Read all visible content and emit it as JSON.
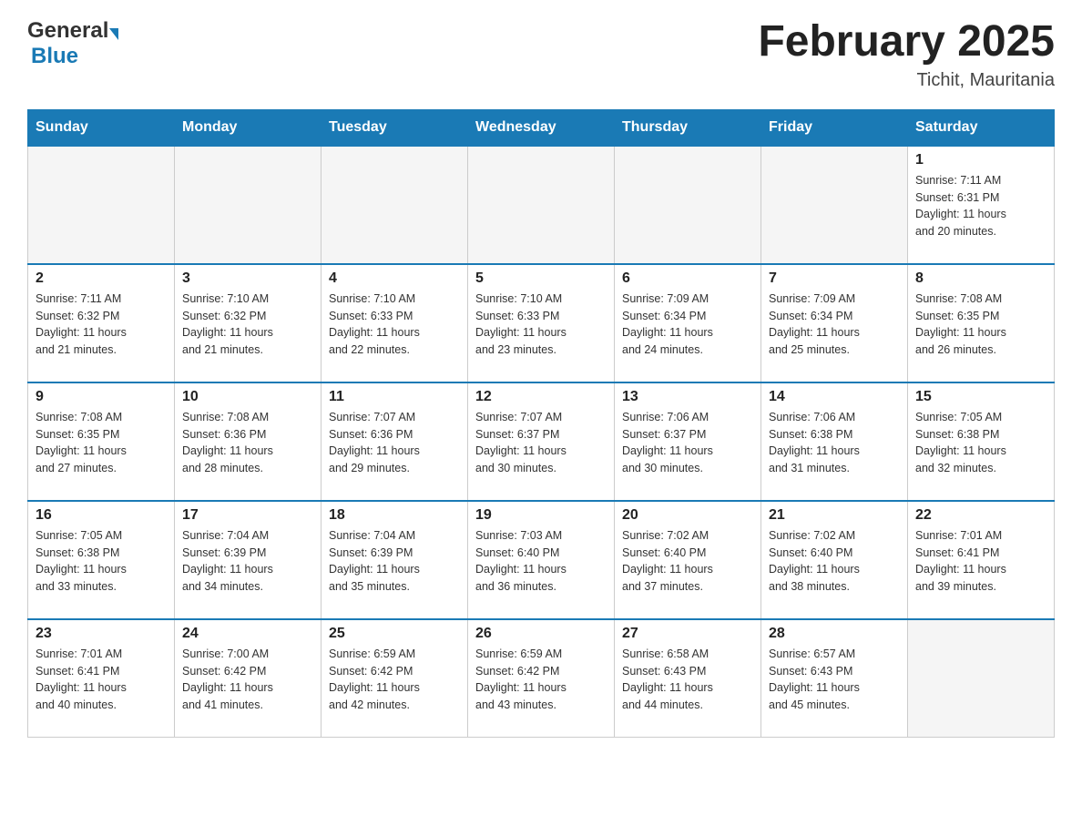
{
  "header": {
    "logo_general": "General",
    "logo_blue": "Blue",
    "title": "February 2025",
    "location": "Tichit, Mauritania"
  },
  "weekdays": [
    "Sunday",
    "Monday",
    "Tuesday",
    "Wednesday",
    "Thursday",
    "Friday",
    "Saturday"
  ],
  "weeks": [
    [
      {
        "day": "",
        "info": ""
      },
      {
        "day": "",
        "info": ""
      },
      {
        "day": "",
        "info": ""
      },
      {
        "day": "",
        "info": ""
      },
      {
        "day": "",
        "info": ""
      },
      {
        "day": "",
        "info": ""
      },
      {
        "day": "1",
        "info": "Sunrise: 7:11 AM\nSunset: 6:31 PM\nDaylight: 11 hours\nand 20 minutes."
      }
    ],
    [
      {
        "day": "2",
        "info": "Sunrise: 7:11 AM\nSunset: 6:32 PM\nDaylight: 11 hours\nand 21 minutes."
      },
      {
        "day": "3",
        "info": "Sunrise: 7:10 AM\nSunset: 6:32 PM\nDaylight: 11 hours\nand 21 minutes."
      },
      {
        "day": "4",
        "info": "Sunrise: 7:10 AM\nSunset: 6:33 PM\nDaylight: 11 hours\nand 22 minutes."
      },
      {
        "day": "5",
        "info": "Sunrise: 7:10 AM\nSunset: 6:33 PM\nDaylight: 11 hours\nand 23 minutes."
      },
      {
        "day": "6",
        "info": "Sunrise: 7:09 AM\nSunset: 6:34 PM\nDaylight: 11 hours\nand 24 minutes."
      },
      {
        "day": "7",
        "info": "Sunrise: 7:09 AM\nSunset: 6:34 PM\nDaylight: 11 hours\nand 25 minutes."
      },
      {
        "day": "8",
        "info": "Sunrise: 7:08 AM\nSunset: 6:35 PM\nDaylight: 11 hours\nand 26 minutes."
      }
    ],
    [
      {
        "day": "9",
        "info": "Sunrise: 7:08 AM\nSunset: 6:35 PM\nDaylight: 11 hours\nand 27 minutes."
      },
      {
        "day": "10",
        "info": "Sunrise: 7:08 AM\nSunset: 6:36 PM\nDaylight: 11 hours\nand 28 minutes."
      },
      {
        "day": "11",
        "info": "Sunrise: 7:07 AM\nSunset: 6:36 PM\nDaylight: 11 hours\nand 29 minutes."
      },
      {
        "day": "12",
        "info": "Sunrise: 7:07 AM\nSunset: 6:37 PM\nDaylight: 11 hours\nand 30 minutes."
      },
      {
        "day": "13",
        "info": "Sunrise: 7:06 AM\nSunset: 6:37 PM\nDaylight: 11 hours\nand 30 minutes."
      },
      {
        "day": "14",
        "info": "Sunrise: 7:06 AM\nSunset: 6:38 PM\nDaylight: 11 hours\nand 31 minutes."
      },
      {
        "day": "15",
        "info": "Sunrise: 7:05 AM\nSunset: 6:38 PM\nDaylight: 11 hours\nand 32 minutes."
      }
    ],
    [
      {
        "day": "16",
        "info": "Sunrise: 7:05 AM\nSunset: 6:38 PM\nDaylight: 11 hours\nand 33 minutes."
      },
      {
        "day": "17",
        "info": "Sunrise: 7:04 AM\nSunset: 6:39 PM\nDaylight: 11 hours\nand 34 minutes."
      },
      {
        "day": "18",
        "info": "Sunrise: 7:04 AM\nSunset: 6:39 PM\nDaylight: 11 hours\nand 35 minutes."
      },
      {
        "day": "19",
        "info": "Sunrise: 7:03 AM\nSunset: 6:40 PM\nDaylight: 11 hours\nand 36 minutes."
      },
      {
        "day": "20",
        "info": "Sunrise: 7:02 AM\nSunset: 6:40 PM\nDaylight: 11 hours\nand 37 minutes."
      },
      {
        "day": "21",
        "info": "Sunrise: 7:02 AM\nSunset: 6:40 PM\nDaylight: 11 hours\nand 38 minutes."
      },
      {
        "day": "22",
        "info": "Sunrise: 7:01 AM\nSunset: 6:41 PM\nDaylight: 11 hours\nand 39 minutes."
      }
    ],
    [
      {
        "day": "23",
        "info": "Sunrise: 7:01 AM\nSunset: 6:41 PM\nDaylight: 11 hours\nand 40 minutes."
      },
      {
        "day": "24",
        "info": "Sunrise: 7:00 AM\nSunset: 6:42 PM\nDaylight: 11 hours\nand 41 minutes."
      },
      {
        "day": "25",
        "info": "Sunrise: 6:59 AM\nSunset: 6:42 PM\nDaylight: 11 hours\nand 42 minutes."
      },
      {
        "day": "26",
        "info": "Sunrise: 6:59 AM\nSunset: 6:42 PM\nDaylight: 11 hours\nand 43 minutes."
      },
      {
        "day": "27",
        "info": "Sunrise: 6:58 AM\nSunset: 6:43 PM\nDaylight: 11 hours\nand 44 minutes."
      },
      {
        "day": "28",
        "info": "Sunrise: 6:57 AM\nSunset: 6:43 PM\nDaylight: 11 hours\nand 45 minutes."
      },
      {
        "day": "",
        "info": ""
      }
    ]
  ]
}
